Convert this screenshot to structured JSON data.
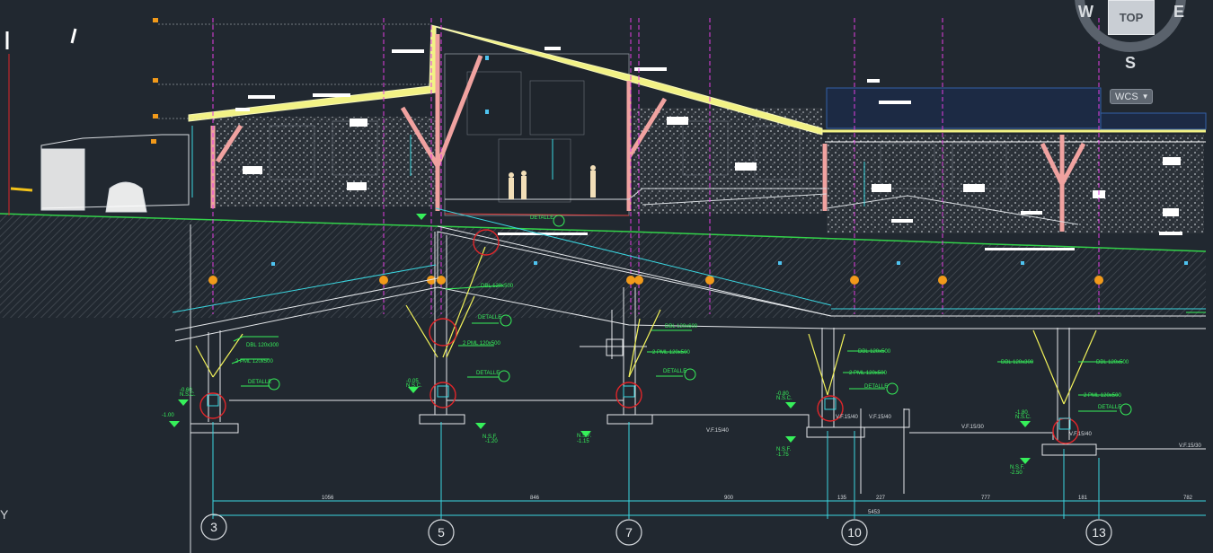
{
  "viewcube": {
    "face": "TOP",
    "north": "",
    "west": "W",
    "east": "E",
    "south": "S"
  },
  "wcs": {
    "label": "WCS"
  },
  "ucs": {
    "y_label": "Y"
  },
  "grid": {
    "bubbles_bottom": [
      "3",
      "5",
      "7",
      "10",
      "13"
    ]
  },
  "callouts": {
    "detalle": "DETALLE",
    "duo_beam": "DBL 120x500",
    "pml": "2 PML 120x500",
    "beam_300": "DBL 120x300",
    "beam_600": "DBL 120x600",
    "nsc_label": "N.S.C.",
    "nsf_label": "N.S.F.",
    "vf": "V.F.15/30",
    "vf2": "V.F.15/40"
  },
  "levels": {
    "l1": "-0.60",
    "l2": "-1.00",
    "l3": "-0.05",
    "l4": "-1.20",
    "l5": "-1.15",
    "l6": "-0.80",
    "l7": "-1.75",
    "l8": "-1.80",
    "l9": "-2.50"
  },
  "dims": {
    "d1": "1056",
    "d2": "846",
    "d3": "900",
    "d4": "135",
    "d5": "227",
    "d6": "777",
    "d7": "181",
    "d8": "782",
    "total": "5453"
  },
  "colors": {
    "background": "#212830",
    "grid": "#e23ee2",
    "dimension": "#3ad6e0",
    "annotation": "#36f05a",
    "structure": "#ffffff",
    "roof": "#f2f285",
    "detail_circle": "#e0262a"
  }
}
